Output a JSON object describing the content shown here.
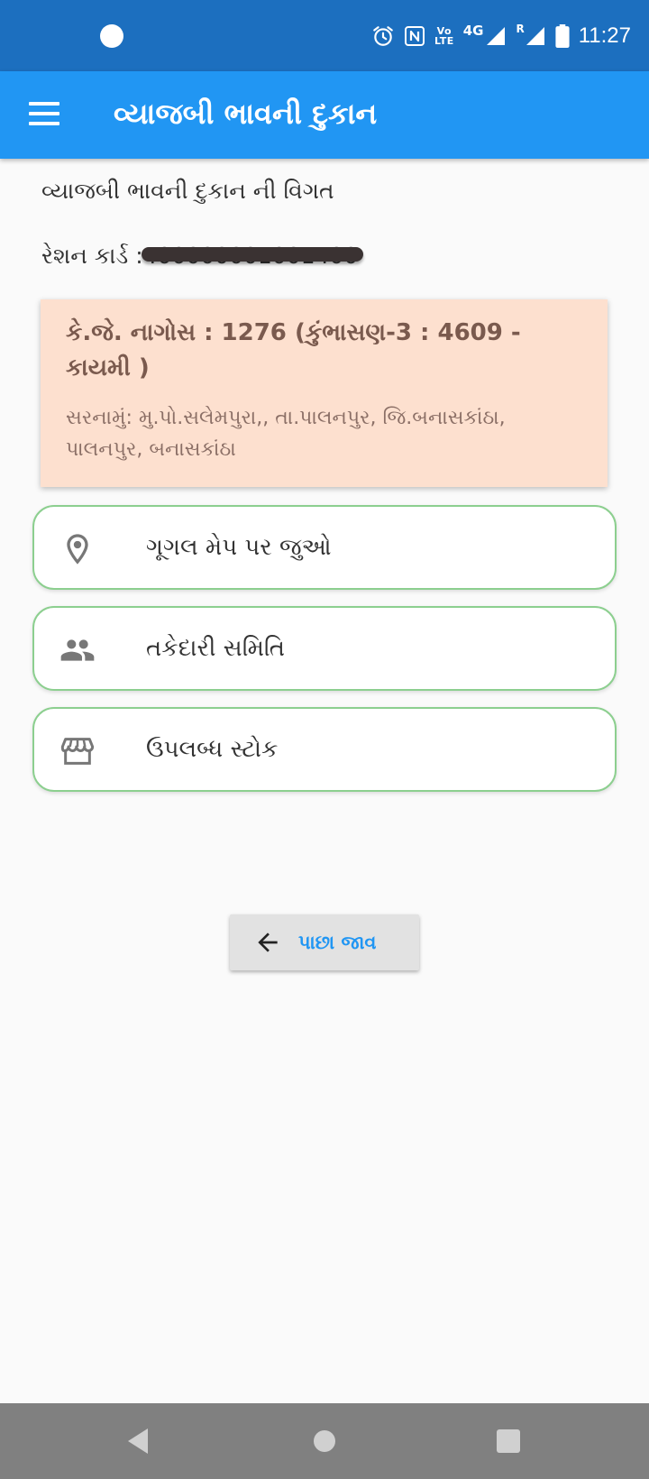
{
  "status_bar": {
    "volte_top": "Vo",
    "volte_bottom": "LTE",
    "network": "4G",
    "roaming": "R",
    "time": "11:27"
  },
  "app_bar": {
    "title": "વ્યાજબી ભાવની દુકાન"
  },
  "content": {
    "heading": "વ્યાજબી ભાવની દુકાન ની વિગત",
    "ration_label": "રેશન કાર્ડ :",
    "ration_number": "400000001001400"
  },
  "shop": {
    "name": "કે.જે. નાગોસ : 1276 (કુંભાસણ-3 : 4609 - કાયમી )",
    "address": "સરનામું: મુ.પો.સલેમપુરા,, તા.પાલનપુર, જિ.બનાસકાંઠા, પાલનપુર, બનાસકાંઠા"
  },
  "options": [
    {
      "label": "ગૂગલ મેપ પર જુઓ",
      "icon": "map-pin-icon"
    },
    {
      "label": "તકેદારી સમિતિ",
      "icon": "people-icon"
    },
    {
      "label": "ઉપલબ્ધ સ્ટોક",
      "icon": "store-icon"
    }
  ],
  "back_button": {
    "label": "પાછા જાવ",
    "icon": "arrow-left-icon"
  },
  "colors": {
    "status_bar": "#1c6fbf",
    "app_bar": "#2196f3",
    "shop_card": "#fde0cf",
    "option_border": "#8ccf8f",
    "accent_text": "#2196f3"
  }
}
